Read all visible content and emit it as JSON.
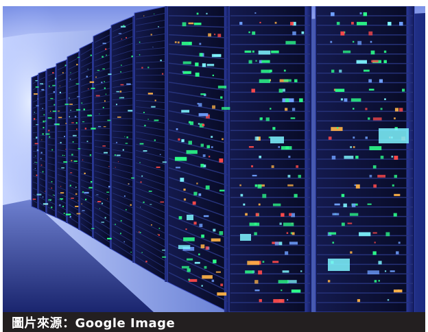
{
  "image": {
    "subject": "server-room",
    "colors": {
      "background_haze": "#8fa6e8",
      "rack_dark": "#0b1030",
      "rack_mid": "#1a2160",
      "floor": "#3c4fb0",
      "led_green": "#2dff8a",
      "led_red": "#ff4a4a",
      "led_cyan": "#7ff6ff",
      "led_orange": "#ffb347",
      "caption_bg": "#231f20",
      "caption_fg": "#ffffff"
    }
  },
  "caption": {
    "text": "圖片來源：Google Image"
  }
}
